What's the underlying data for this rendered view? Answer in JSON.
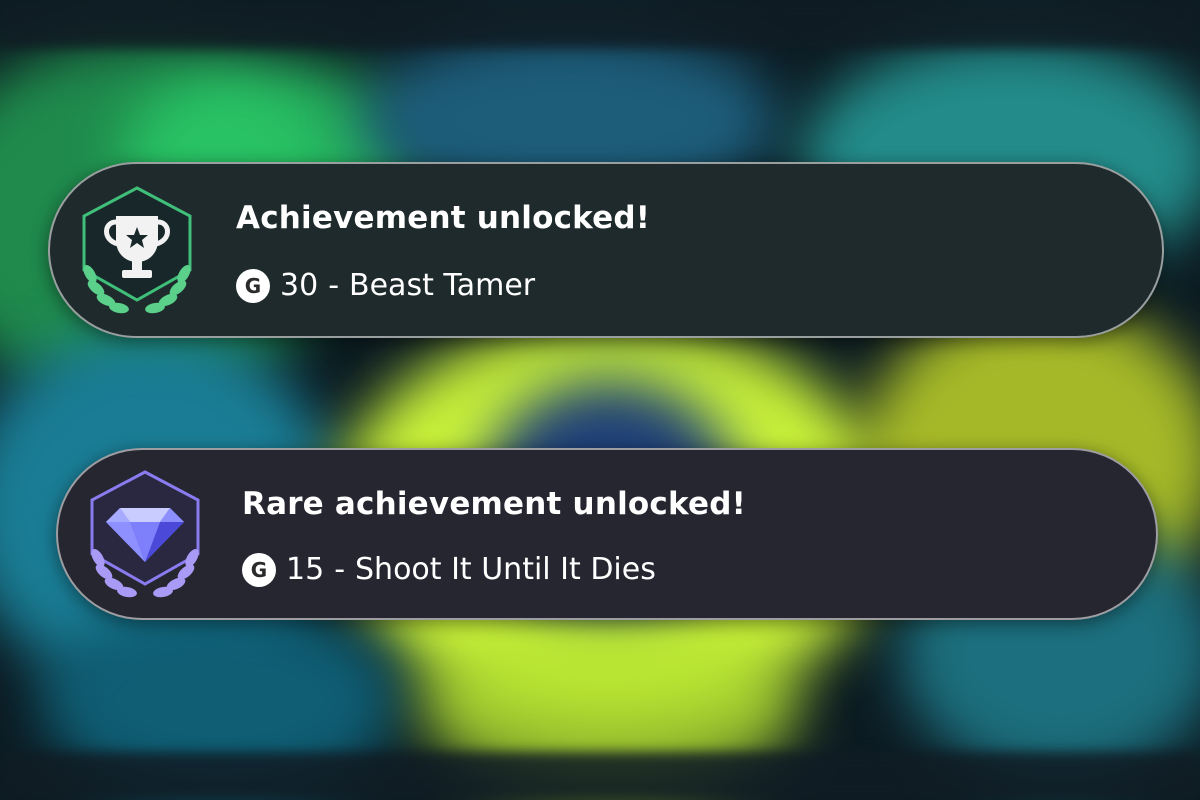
{
  "notifications": [
    {
      "title": "Achievement unlocked!",
      "gamerscore_icon": "G",
      "score": "30",
      "separator": "-",
      "name": "Beast Tamer",
      "badge_icon": "trophy-icon",
      "accent_color": "#3fbf7a",
      "card_color": "#1e2a2c"
    },
    {
      "title": "Rare achievement unlocked!",
      "gamerscore_icon": "G",
      "score": "15",
      "separator": "-",
      "name": "Shoot It Until It Dies",
      "badge_icon": "diamond-icon",
      "accent_color": "#8a7cf0",
      "card_color": "#262631"
    }
  ]
}
